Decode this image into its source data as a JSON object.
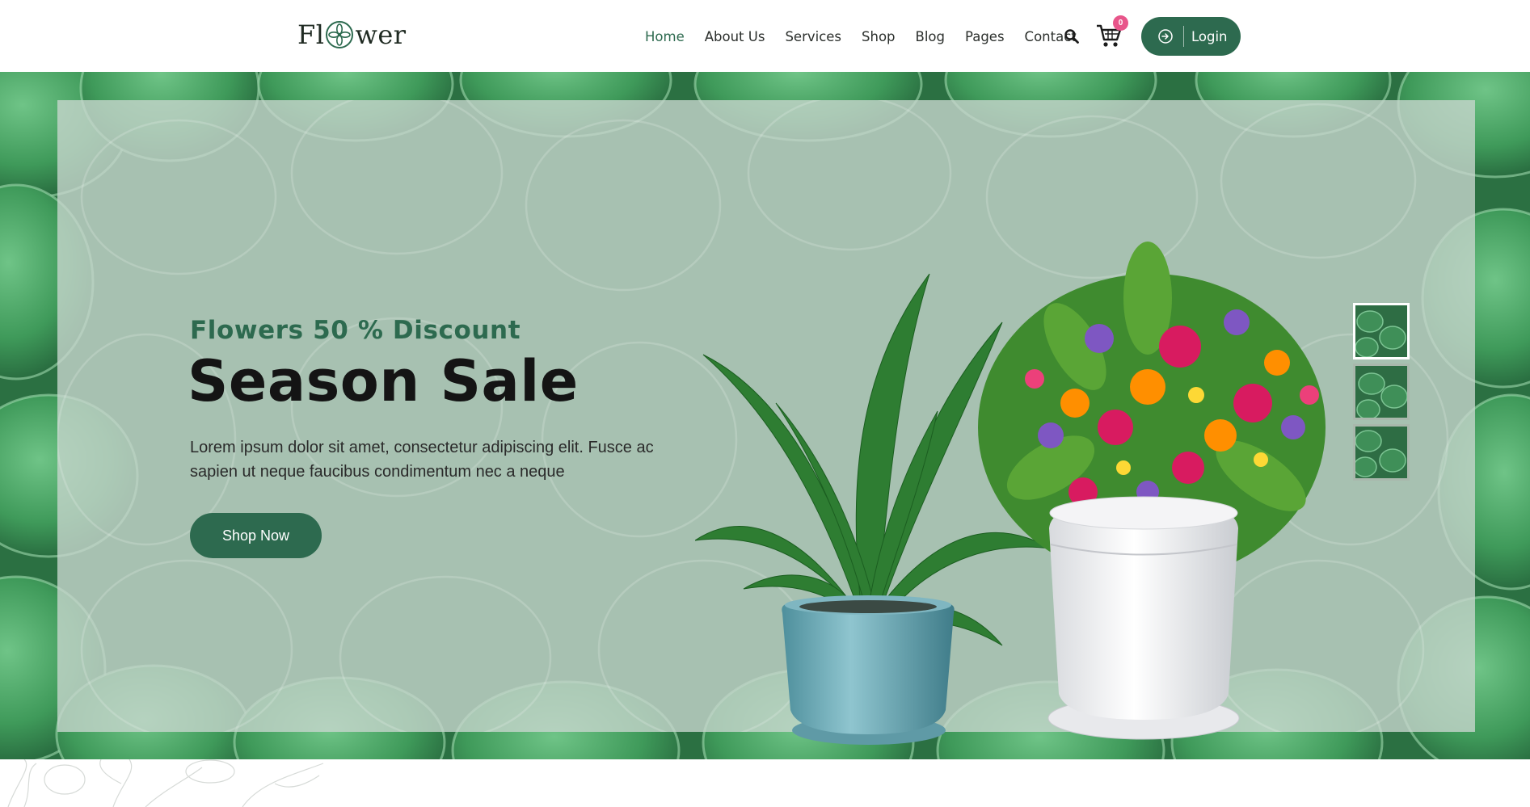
{
  "brand": {
    "logo_prefix": "Fl",
    "logo_suffix": "wer",
    "logo_icon": "flower-logo-icon",
    "primary_color": "#2d6a4f",
    "badge_color": "#e8558a"
  },
  "nav": {
    "items": [
      {
        "label": "Home",
        "active": true
      },
      {
        "label": "About Us",
        "active": false
      },
      {
        "label": "Services",
        "active": false
      },
      {
        "label": "Shop",
        "active": false
      },
      {
        "label": "Blog",
        "active": false
      },
      {
        "label": "Pages",
        "active": false
      },
      {
        "label": "Contact",
        "active": false
      }
    ],
    "search_icon": "search-icon",
    "cart_icon": "cart-icon",
    "cart_count": "0",
    "login_icon": "login-arrow-icon",
    "login_label": "Login"
  },
  "hero": {
    "subtitle": "Flowers 50 % Discount",
    "title": "Season Sale",
    "description": "Lorem ipsum dolor sit amet, consectetur adipiscing elit. Fusce ac sapien ut neque faucibus condimentum nec a neque",
    "cta_label": "Shop Now",
    "slide_thumbnails": 3,
    "active_thumbnail": 1
  }
}
